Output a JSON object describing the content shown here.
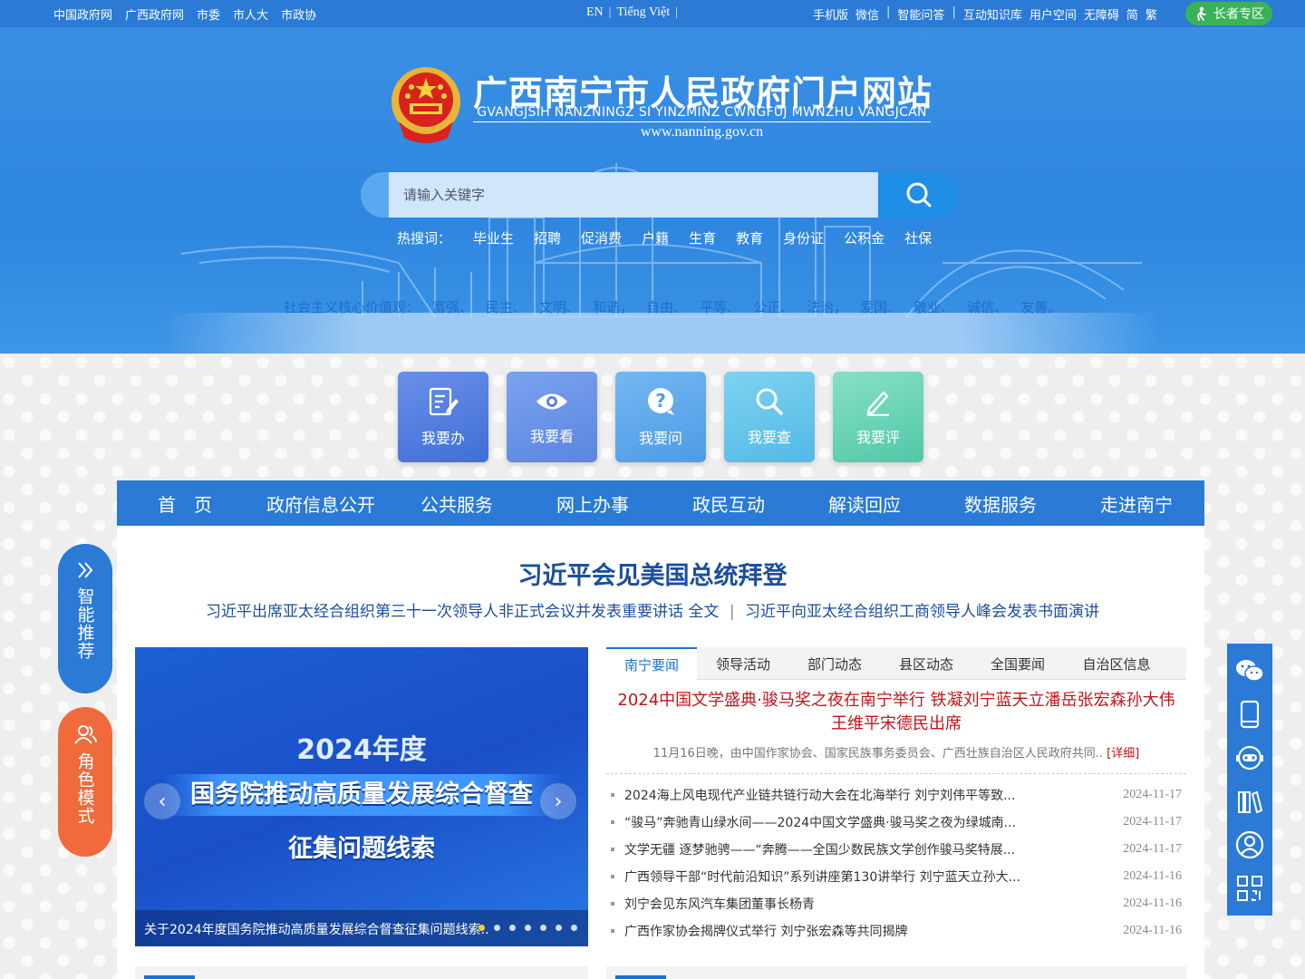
{
  "topbar": {
    "left_links": [
      "中国政府网",
      "广西政府网",
      "市委",
      "市人大",
      "市政协"
    ],
    "languages": [
      "EN",
      "Tiếng Việt"
    ],
    "right_links": [
      "手机版",
      "微信",
      "智能问答",
      "互动知识库",
      "用户空间",
      "无障碍",
      "简",
      "繁"
    ],
    "elder_label": "长者专区"
  },
  "header": {
    "title": "广西南宁市人民政府门户网站",
    "subtitle": "GVANGJSIH NANZNINGZ SI YINZMINZ CWNGFUJ MWNZHU VANGJCAN",
    "url": "www.nanning.gov.cn"
  },
  "search": {
    "placeholder": "请输入关键字",
    "hot_label": "热搜词：",
    "hot_words": [
      "毕业生",
      "招聘",
      "促消费",
      "户籍",
      "生育",
      "教育",
      "身份证",
      "公积金",
      "社保"
    ]
  },
  "values": {
    "label": "社会主义核心价值观：",
    "items": [
      "富强、",
      "民主、",
      "文明、",
      "和谐，",
      "自由、",
      "平等、",
      "公正、",
      "法治，",
      "爱国、",
      "敬业、",
      "诚信、",
      "友善。"
    ]
  },
  "tiles": [
    {
      "label": "我要办",
      "icon": "edit-doc-icon"
    },
    {
      "label": "我要看",
      "icon": "eye-icon"
    },
    {
      "label": "我要问",
      "icon": "question-icon"
    },
    {
      "label": "我要查",
      "icon": "search-icon"
    },
    {
      "label": "我要评",
      "icon": "pen-icon"
    }
  ],
  "nav": [
    "首　页",
    "政府信息公开",
    "公共服务",
    "网上办事",
    "政民互动",
    "解读回应",
    "数据服务",
    "走进南宁"
  ],
  "headline": {
    "title": "习近平会见美国总统拜登",
    "sub1": "习近平出席亚太经合组织第三十一次领导人非正式会议并发表重要讲话 全文",
    "sep": "|",
    "sub2": "习近平向亚太经合组织工商领导人峰会发表书面演讲"
  },
  "carousel": {
    "year": "2024年度",
    "line1": "国务院推动高质量发展综合督查",
    "line2": "征集问题线索",
    "caption": "关于2024年度国务院推动高质量发展综合督查征集问题线索..",
    "prev": "‹",
    "next": "›",
    "slide_count": 7,
    "active_index": 0
  },
  "news": {
    "tabs": [
      "南宁要闻",
      "领导活动",
      "部门动态",
      "县区动态",
      "全国要闻",
      "自治区信息"
    ],
    "active_tab": 0,
    "top_title": "2024中国文学盛典·骏马奖之夜在南宁举行 铁凝刘宁蓝天立潘岳张宏森孙大伟王维平宋德民出席",
    "top_summary": "11月16日晚，由中国作家协会、国家民族事务委员会、广西壮族自治区人民政府共同..",
    "detail_label": "[详细]",
    "items": [
      {
        "title": "2024海上风电现代产业链共链行动大会在北海举行 刘宁刘伟平等致...",
        "date": "2024-11-17"
      },
      {
        "title": "“骏马”奔驰青山绿水间——2024中国文学盛典·骏马奖之夜为绿城南...",
        "date": "2024-11-17"
      },
      {
        "title": "文学无疆 逐梦驰骋——“奔腾——全国少数民族文学创作骏马奖特展...",
        "date": "2024-11-17"
      },
      {
        "title": "广西领导干部“时代前沿知识”系列讲座第130讲举行 刘宁蓝天立孙大...",
        "date": "2024-11-16"
      },
      {
        "title": "刘宁会见东风汽车集团董事长杨青",
        "date": "2024-11-16"
      },
      {
        "title": "广西作家协会揭牌仪式举行 刘宁张宏森等共同揭牌",
        "date": "2024-11-16"
      }
    ]
  },
  "side": {
    "smart_label": "智能推荐",
    "role_label": "角色模式"
  },
  "right_toolbar": [
    "wechat-icon",
    "mobile-icon",
    "robot-icon",
    "books-icon",
    "user-icon",
    "qrcode-icon"
  ],
  "colors": {
    "brand_blue": "#2a7ad6",
    "headline_blue": "#1b4fa0",
    "news_red": "#c4141b",
    "elder_green": "#3bb25a",
    "role_orange": "#f06a3c"
  }
}
